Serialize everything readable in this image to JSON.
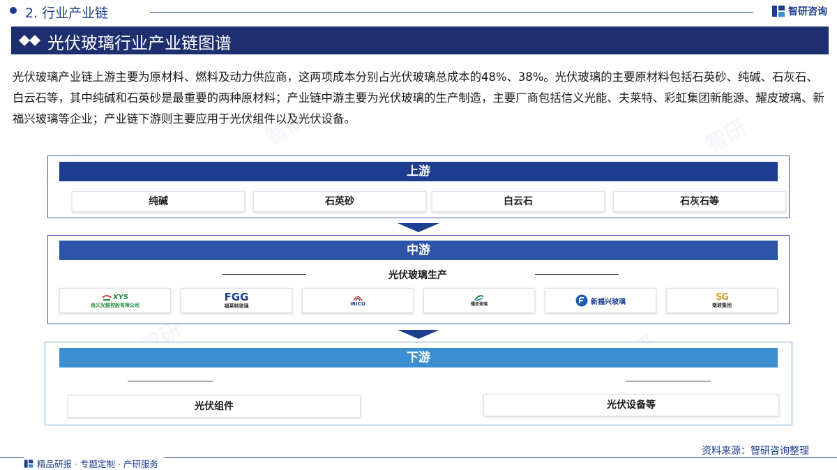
{
  "header": {
    "section": "2. 行业产业链",
    "brand": "智研咨询"
  },
  "title": "光伏玻璃行业产业链图谱",
  "description": "光伏玻璃产业链上游主要为原材料、燃料及动力供应商，这两项成本分别占光伏玻璃总成本的48%、38%。光伏玻璃的主要原材料包括石英砂、纯碱、石灰石、白云石等，其中纯碱和石英砂是最重要的两种原材料；产业链中游主要为光伏玻璃的生产制造，主要厂商包括信义光能、夫莱特、彩虹集团新能源、耀皮玻璃、新福兴玻璃等企业；产业链下游则主要应用于光伏组件以及光伏设备。",
  "upstream": {
    "label": "上游",
    "items": [
      "纯碱",
      "石英砂",
      "白云石",
      "石灰石等"
    ]
  },
  "midstream": {
    "label": "中游",
    "subtitle": "光伏玻璃生产",
    "logos": [
      {
        "icon": "xinyi-solar-logo",
        "mark": "XYS",
        "text": "信义光能控股有限公司"
      },
      {
        "icon": "flat-glass-logo",
        "mark": "FGG",
        "text": "福莱特玻璃"
      },
      {
        "icon": "irico-logo",
        "mark": "IRICO",
        "text": ""
      },
      {
        "icon": "yaopi-glass-logo",
        "mark": "",
        "text": "耀皮玻璃"
      },
      {
        "icon": "xinfuxing-glass-logo",
        "mark": "新福兴玻璃",
        "text": ""
      },
      {
        "icon": "nanbo-group-logo",
        "mark": "SG",
        "text": "南玻集团"
      }
    ]
  },
  "downstream": {
    "label": "下游",
    "items": [
      "光伏组件",
      "光伏设备等"
    ]
  },
  "source": "资料来源：智研咨询整理",
  "footer": "精品研报 · 专题定制 · 产研服务",
  "colors": {
    "navy": "#1d2f6e",
    "header_dark": "#1d3d8e",
    "header_mid": "#2c54a8",
    "header_light": "#3b8fd0"
  }
}
